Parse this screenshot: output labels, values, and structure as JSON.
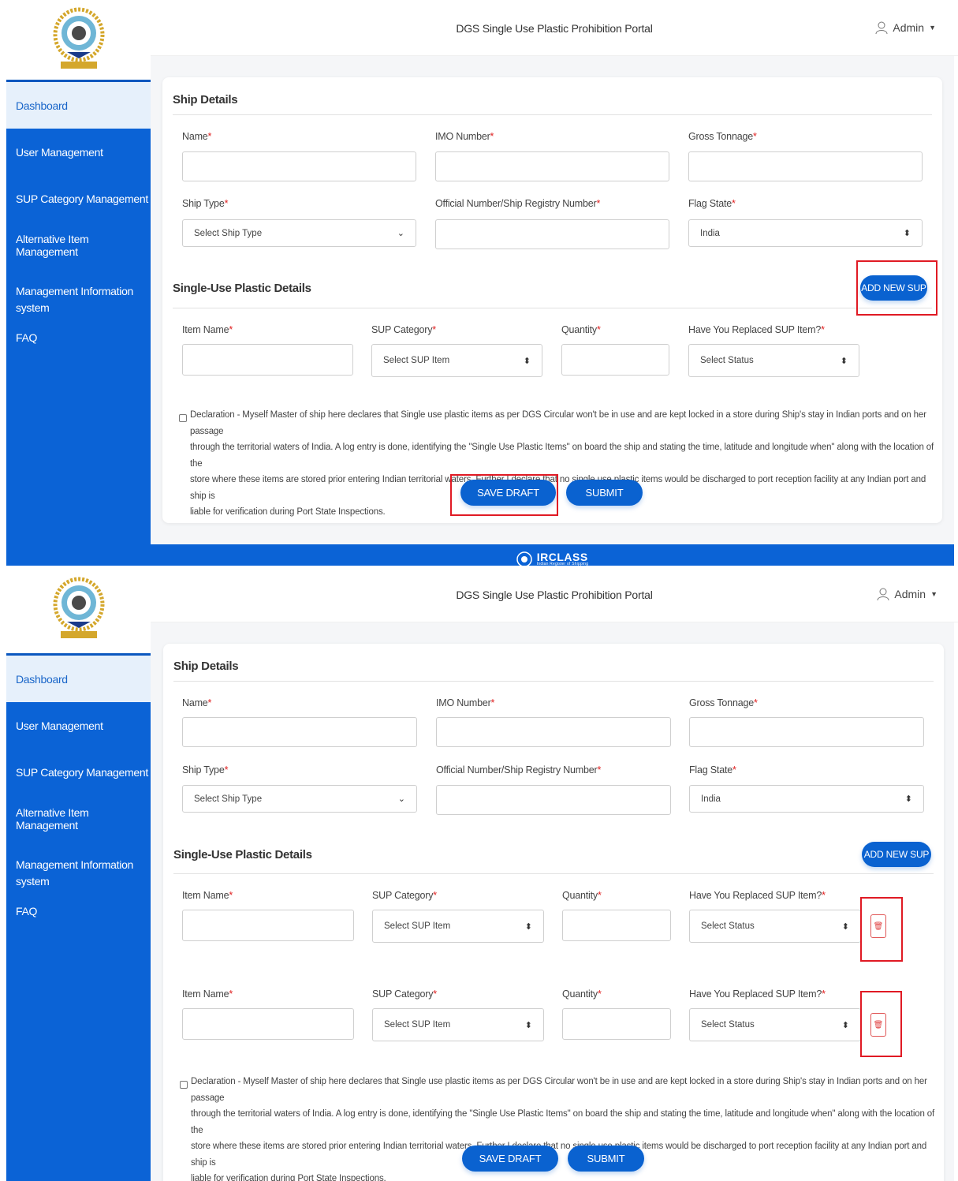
{
  "portal_title": "DGS Single Use Plastic Prohibition Portal",
  "user_menu": {
    "label": "Admin"
  },
  "sidebar": {
    "items": [
      {
        "label": "Dashboard"
      },
      {
        "label": "User Management"
      },
      {
        "label": "SUP Category Management"
      },
      {
        "label": "Alternative Item Management"
      },
      {
        "label": "Management Information system"
      },
      {
        "label": "FAQ"
      }
    ]
  },
  "ship_details": {
    "title": "Ship Details",
    "name_label": "Name",
    "imo_label": "IMO Number",
    "gross_tonnage_label": "Gross Tonnage",
    "ship_type_label": "Ship Type",
    "ship_type_placeholder": "Select Ship Type",
    "official_number_label": "Official Number/Ship Registry Number",
    "flag_state_label": "Flag State",
    "flag_state_value": "India",
    "required_mark": "*"
  },
  "sup_details": {
    "title": "Single-Use Plastic Details",
    "add_button": "ADD NEW SUP",
    "item_name_label": "Item Name",
    "category_label": "SUP Category",
    "category_placeholder": "Select SUP Item",
    "quantity_label": "Quantity",
    "replaced_label": "Have You Replaced SUP Item?",
    "replaced_placeholder": "Select Status"
  },
  "declaration": {
    "line1": "Declaration - Myself Master of ship here declares that Single use plastic items as per DGS Circular won't be in use and are kept locked in a store during Ship's stay in Indian ports and on her passage",
    "line2": "through the territorial waters of India. A log entry is done, identifying the \"Single Use Plastic Items\" on board the ship and stating the time, latitude and longitude when\" along with the location of the",
    "line3": "store where these items are stored prior entering Indian territorial waters. Further I declare that no single use plastic items would be discharged to port reception facility at any Indian port and ship is",
    "line4": "liable for verification during Port State Inspections."
  },
  "actions": {
    "save_draft": "SAVE DRAFT",
    "submit": "SUBMIT"
  },
  "footer": {
    "brand": "IRCLASS",
    "tagline": "Indian Register of Shipping"
  },
  "colors": {
    "primary": "#0b63d6",
    "highlight": "#e01a24",
    "required": "#e02020"
  }
}
